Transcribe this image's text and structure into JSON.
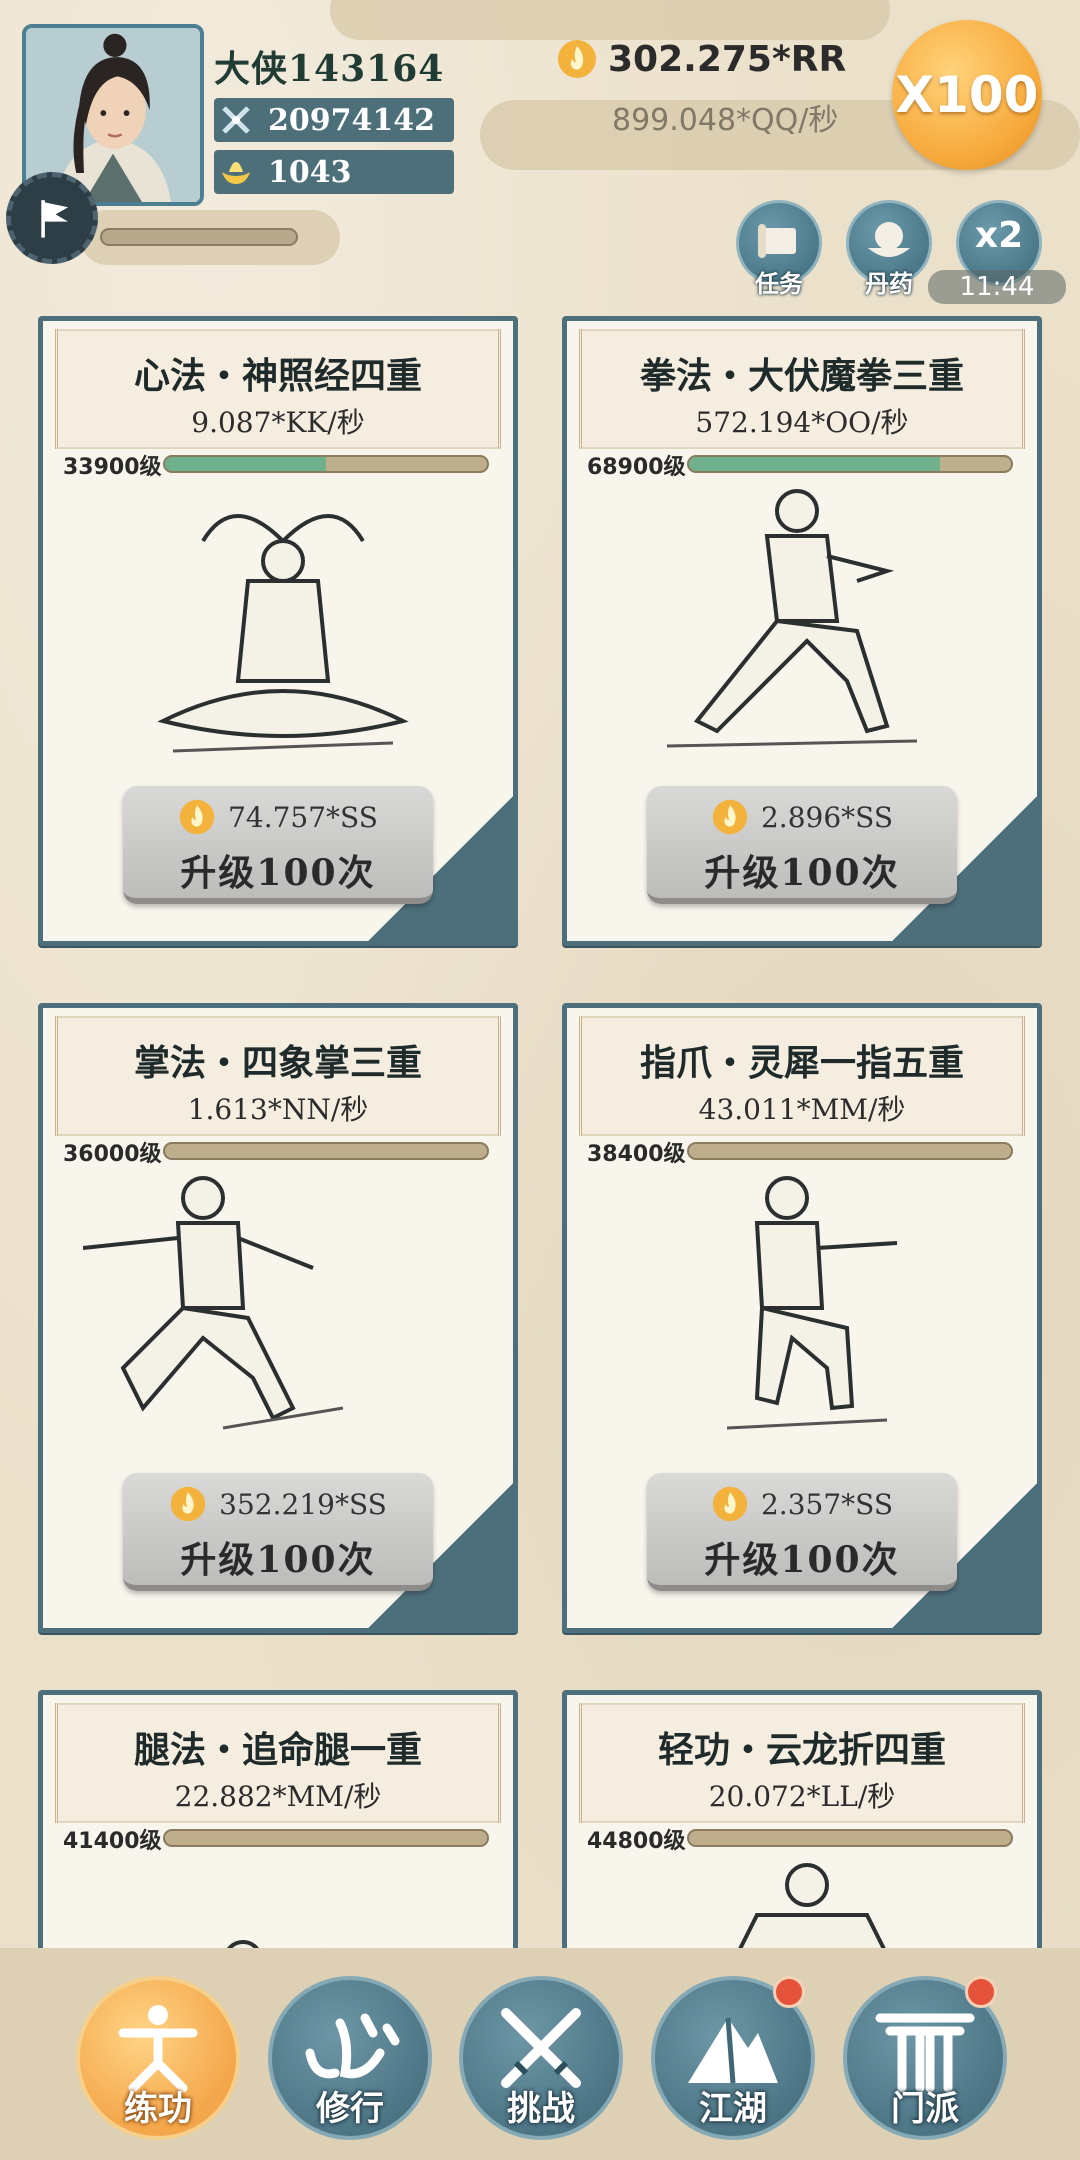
{
  "player": {
    "name": "大侠143164",
    "power": "20974142",
    "gold": "1043"
  },
  "currency": {
    "amount": "302.275*RR",
    "rate": "899.048*QQ/秒"
  },
  "multiplier_button": "X100",
  "quick_actions": {
    "task_label": "任务",
    "elixir_label": "丹药",
    "speed_label": "x2",
    "speed_timer": "11:44"
  },
  "skills": [
    {
      "title": "心法・神照经四重",
      "rate": "9.087*KK/秒",
      "level": "33900级",
      "progress": 0.5,
      "cost": "74.757*SS",
      "upgrade": "升级100次"
    },
    {
      "title": "拳法・大伏魔拳三重",
      "rate": "572.194*OO/秒",
      "level": "68900级",
      "progress": 0.78,
      "cost": "2.896*SS",
      "upgrade": "升级100次"
    },
    {
      "title": "掌法・四象掌三重",
      "rate": "1.613*NN/秒",
      "level": "36000级",
      "progress": 0.0,
      "cost": "352.219*SS",
      "upgrade": "升级100次"
    },
    {
      "title": "指爪・灵犀一指五重",
      "rate": "43.011*MM/秒",
      "level": "38400级",
      "progress": 0.0,
      "cost": "2.357*SS",
      "upgrade": "升级100次"
    },
    {
      "title": "腿法・追命腿一重",
      "rate": "22.882*MM/秒",
      "level": "41400级",
      "progress": 0.0
    },
    {
      "title": "轻功・云龙折四重",
      "rate": "20.072*LL/秒",
      "level": "44800级",
      "progress": 0.0
    }
  ],
  "nav": {
    "practice": "练功",
    "cultivate": "修行",
    "challenge": "挑战",
    "jianghu": "江湖",
    "sect": "门派"
  },
  "colors": {
    "primary_teal": "#4d6f7b",
    "progress_green": "#6fb08d",
    "active_orange": "#f4a64a",
    "notification_red": "#e4533a"
  }
}
